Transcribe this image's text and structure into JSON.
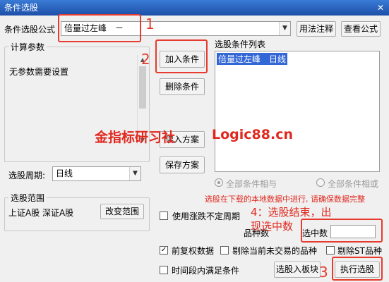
{
  "window": {
    "title": "条件选股",
    "close_glyph": "✕"
  },
  "formula": {
    "label": "条件选股公式",
    "value": "倍量过左峰　－",
    "dropdown_glyph": "▼"
  },
  "buttons": {
    "usage": "用法注释",
    "view_formula": "查看公式",
    "add_condition": "加入条件",
    "delete_condition": "删除条件",
    "read_plan": "读入方案",
    "save_plan": "保存方案",
    "change_range": "改变范围",
    "to_block": "选股入板块",
    "execute": "执行选股"
  },
  "params": {
    "title": "计算参数",
    "none_text": "无参数需要设置"
  },
  "period": {
    "label": "选股周期:",
    "value": "日线"
  },
  "conditions": {
    "title": "选股条件列表",
    "items": [
      "倍量过左峰　日线"
    ]
  },
  "logic": {
    "and_label": "全部条件相与",
    "or_label": "全部条件相或"
  },
  "notice": "选股在下载的本地数据中进行, 请确保数据完整",
  "range": {
    "title": "选股范围",
    "value": "上证A股 深证A股"
  },
  "options": {
    "use_limit": "使用涨跌不定周期",
    "forward_adjust": "前复权数据",
    "exclude_untraded": "剔除当前未交易的品种",
    "exclude_st": "剔除ST品种",
    "time_range": "时间段内满足条件"
  },
  "counts": {
    "varieties_label": "品种数",
    "selected_label": "选中数"
  },
  "annotations": {
    "n1": "1",
    "n2": "2",
    "n3": "3",
    "step4_line1": "4：选股结束，出",
    "step4_line2": "现选中数"
  },
  "watermark": {
    "left": "金指标研习社",
    "right": "Logic88.cn"
  },
  "colors": {
    "accent_red": "#e0281e",
    "selection_blue": "#3367d6",
    "title_blue": "#2a65c4"
  }
}
